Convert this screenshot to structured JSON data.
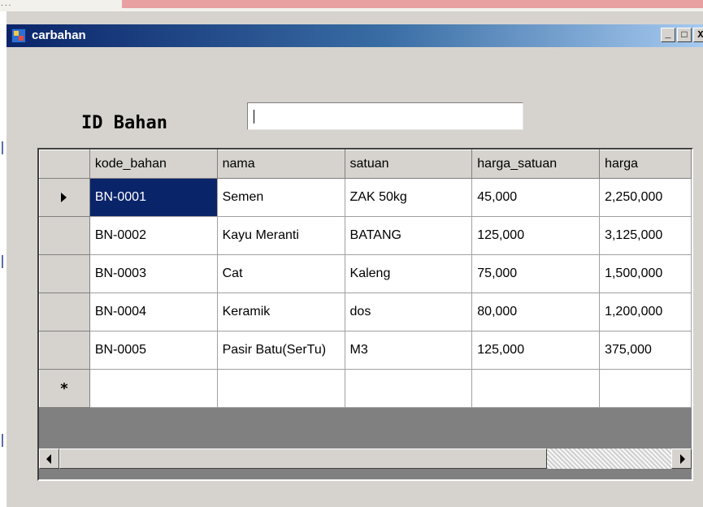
{
  "background": {
    "partial_label": "..."
  },
  "window": {
    "title": "carbahan",
    "buttons": {
      "minimize": "_",
      "maximize": "□",
      "close": "X"
    }
  },
  "form": {
    "id_label": "ID Bahan",
    "id_input_value": ""
  },
  "grid": {
    "columns": [
      "kode_bahan",
      "nama",
      "satuan",
      "harga_satuan",
      "harga"
    ],
    "rows": [
      [
        "BN-0001",
        "Semen",
        "ZAK 50kg",
        "45,000",
        "2,250,000"
      ],
      [
        "BN-0002",
        "Kayu Meranti",
        "BATANG",
        "125,000",
        "3,125,000"
      ],
      [
        "BN-0003",
        "Cat",
        "Kaleng",
        "75,000",
        "1,500,000"
      ],
      [
        "BN-0004",
        "Keramik",
        "dos",
        "80,000",
        "1,200,000"
      ],
      [
        "BN-0005",
        "Pasir Batu(SerTu)",
        "M3",
        "125,000",
        "375,000"
      ]
    ],
    "new_row_marker": "*",
    "current_row_index": 0
  },
  "colors": {
    "title_start": "#0a246a",
    "title_end": "#a6caf0",
    "selection": "#0a246a",
    "face": "#d6d3ce"
  }
}
